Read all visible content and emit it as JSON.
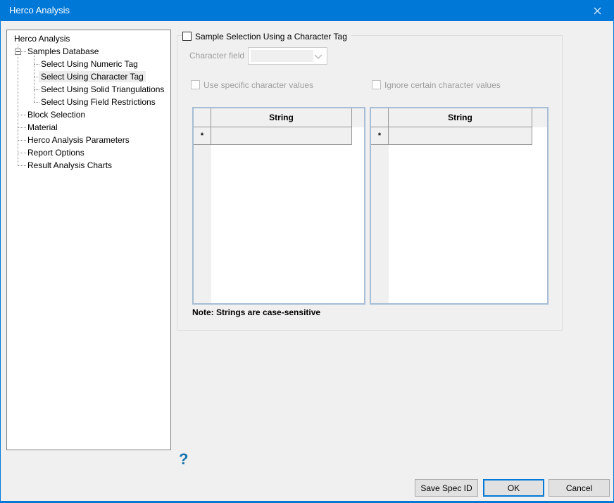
{
  "window": {
    "title": "Herco Analysis"
  },
  "icons": {
    "close": "✕",
    "minus": "−",
    "chevron_down": "⌄"
  },
  "tree": {
    "items": [
      {
        "label": "Herco Analysis",
        "level": 0
      },
      {
        "label": "Samples Database",
        "level": 1,
        "expanded": true
      },
      {
        "label": "Select Using Numeric Tag",
        "level": 2
      },
      {
        "label": "Select Using Character Tag",
        "level": 2,
        "selected": true
      },
      {
        "label": "Select Using Solid Triangulations",
        "level": 2
      },
      {
        "label": "Select Using Field Restrictions",
        "level": 2
      },
      {
        "label": "Block Selection",
        "level": 1
      },
      {
        "label": "Material",
        "level": 1
      },
      {
        "label": "Herco Analysis Parameters",
        "level": 1
      },
      {
        "label": "Report Options",
        "level": 1
      },
      {
        "label": "Result Analysis Charts",
        "level": 1
      }
    ]
  },
  "panel": {
    "group_checkbox_label": "Sample Selection Using a Character Tag",
    "group_checkbox_checked": false,
    "character_field_label": "Character field",
    "character_field_value": "",
    "use_specific_label": "Use specific character values",
    "use_specific_checked": false,
    "ignore_certain_label": "Ignore certain character values",
    "ignore_certain_checked": false,
    "left_grid": {
      "header": "String",
      "new_row_marker": "*",
      "rows": []
    },
    "right_grid": {
      "header": "String",
      "new_row_marker": "*",
      "rows": []
    },
    "note": "Note: Strings are case-sensitive"
  },
  "help": {
    "label": "?"
  },
  "buttons": {
    "save_spec": "Save Spec ID",
    "ok": "OK",
    "cancel": "Cancel"
  },
  "colors": {
    "titlebar": "#0078d7",
    "accent": "#0078d7",
    "grid_border": "#a6bdd5",
    "disabled_text": "#9e9e9e",
    "header_bg": "#f0f0f0",
    "help_blue": "#1673ae"
  }
}
